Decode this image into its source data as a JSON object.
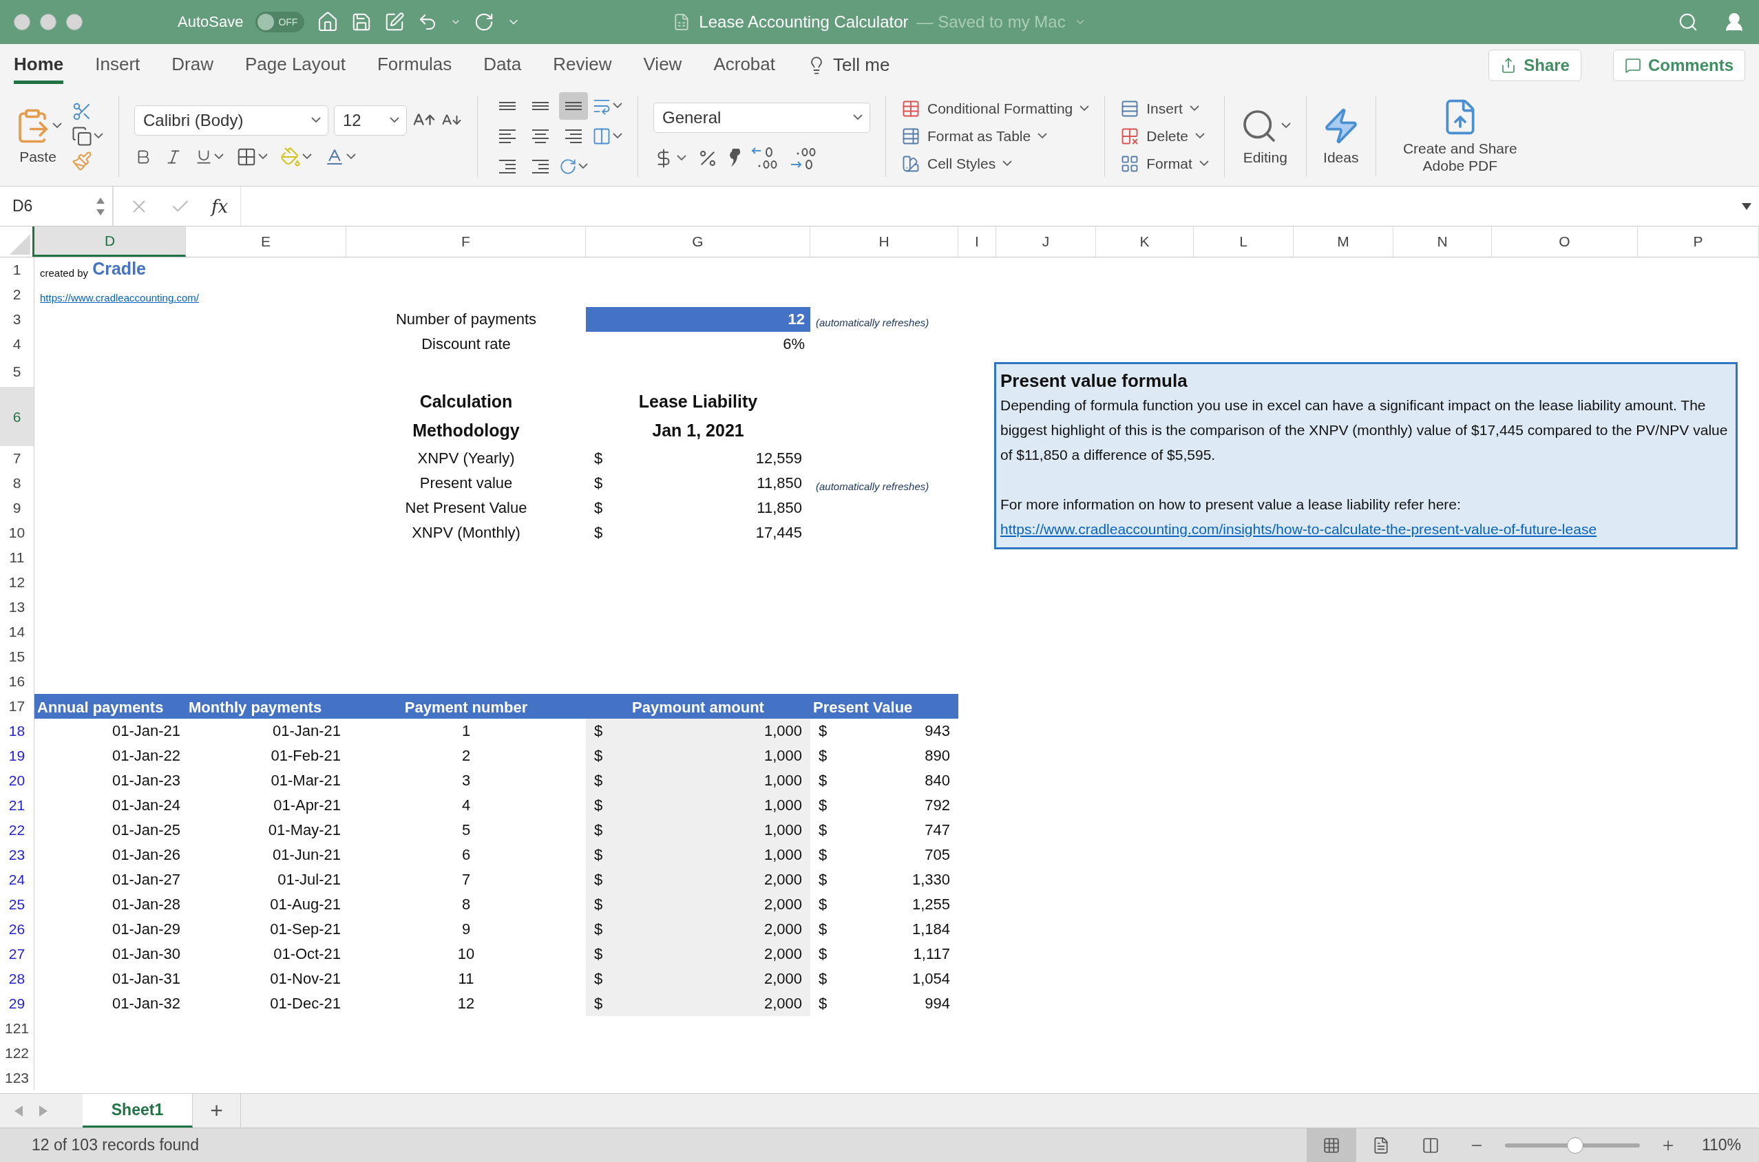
{
  "title_bar": {
    "autosave_label": "AutoSave",
    "autosave_state": "OFF",
    "autosave_on": false,
    "title": "Lease Accounting Calculator",
    "save_status": "— Saved to my Mac"
  },
  "ribbon_tabs": [
    {
      "label": "Home",
      "selected": true
    },
    {
      "label": "Insert",
      "selected": false
    },
    {
      "label": "Draw",
      "selected": false
    },
    {
      "label": "Page Layout",
      "selected": false
    },
    {
      "label": "Formulas",
      "selected": false
    },
    {
      "label": "Data",
      "selected": false
    },
    {
      "label": "Review",
      "selected": false
    },
    {
      "label": "View",
      "selected": false
    },
    {
      "label": "Acrobat",
      "selected": false
    }
  ],
  "tell_me": "Tell me",
  "share": "Share",
  "comments": "Comments",
  "ribbon": {
    "paste": "Paste",
    "font_name": "Calibri (Body)",
    "font_size": "12",
    "vertical_align": [
      {
        "selected": false
      },
      {
        "selected": false
      },
      {
        "selected": true
      }
    ],
    "number_format": "General",
    "styles": [
      "Conditional Formatting",
      "Format as Table",
      "Cell Styles"
    ],
    "cells": [
      "Insert",
      "Delete",
      "Format"
    ],
    "editing": "Editing",
    "ideas": "Ideas",
    "adobe": "Create and Share Adobe PDF"
  },
  "formula_bar": {
    "name_box": "D6",
    "fx_label": "fx"
  },
  "columns": [
    {
      "label": "D",
      "selected": true
    },
    {
      "label": "E",
      "selected": false
    },
    {
      "label": "F",
      "selected": false
    },
    {
      "label": "G",
      "selected": false
    },
    {
      "label": "H",
      "selected": false
    },
    {
      "label": "I",
      "selected": false
    },
    {
      "label": "J",
      "selected": false
    },
    {
      "label": "K",
      "selected": false
    },
    {
      "label": "L",
      "selected": false
    },
    {
      "label": "M",
      "selected": false
    },
    {
      "label": "N",
      "selected": false
    },
    {
      "label": "O",
      "selected": false
    },
    {
      "label": "P",
      "selected": false
    }
  ],
  "rows": [
    {
      "number": "1",
      "selected": false,
      "filtered": false,
      "kind": "credit",
      "prefix": "created by",
      "brand": "Cradle"
    },
    {
      "number": "2",
      "selected": false,
      "filtered": false,
      "kind": "link",
      "url": "https://www.cradleaccounting.com/"
    },
    {
      "number": "3",
      "selected": false,
      "filtered": false,
      "kind": "input",
      "label": "Number of payments",
      "value": "12",
      "highlighted": true,
      "note": "(automatically refreshes)"
    },
    {
      "number": "4",
      "selected": false,
      "filtered": false,
      "kind": "input",
      "label": "Discount rate",
      "value": "6%",
      "highlighted": false
    },
    {
      "number": "5",
      "selected": false,
      "filtered": false,
      "kind": "blank"
    },
    {
      "number": "6",
      "selected": true,
      "filtered": false,
      "kind": "heading",
      "label": "Calculation\nMethodology",
      "value": "Lease Liability\nJan 1, 2021"
    },
    {
      "number": "7",
      "selected": false,
      "filtered": false,
      "kind": "result",
      "label": "XNPV (Yearly)",
      "currency": "$",
      "value": "12,559"
    },
    {
      "number": "8",
      "selected": false,
      "filtered": false,
      "kind": "result",
      "label": "Present value",
      "currency": "$",
      "value": "11,850",
      "note": "(automatically refreshes)"
    },
    {
      "number": "9",
      "selected": false,
      "filtered": false,
      "kind": "result",
      "label": "Net Present Value",
      "currency": "$",
      "value": "11,850"
    },
    {
      "number": "10",
      "selected": false,
      "filtered": false,
      "kind": "result",
      "label": "XNPV (Monthly)",
      "currency": "$",
      "value": "17,445"
    },
    {
      "number": "11",
      "selected": false,
      "filtered": false,
      "kind": "blank"
    },
    {
      "number": "12",
      "selected": false,
      "filtered": false,
      "kind": "blank"
    },
    {
      "number": "13",
      "selected": false,
      "filtered": false,
      "kind": "blank"
    },
    {
      "number": "14",
      "selected": false,
      "filtered": false,
      "kind": "blank"
    },
    {
      "number": "15",
      "selected": false,
      "filtered": false,
      "kind": "blank"
    },
    {
      "number": "16",
      "selected": false,
      "filtered": false,
      "kind": "blank"
    },
    {
      "number": "17",
      "selected": false,
      "filtered": false,
      "kind": "table_header",
      "headers": [
        "Annual payments",
        "Monthly payments",
        "Payment number",
        "Paymount amount",
        "Present Value"
      ]
    },
    {
      "number": "18",
      "selected": false,
      "filtered": true,
      "kind": "payment",
      "annual": "01-Jan-21",
      "monthly": "01-Jan-21",
      "payment": "1",
      "currency": "$",
      "amount": "1,000",
      "pv_currency": "$",
      "pv": "943"
    },
    {
      "number": "19",
      "selected": false,
      "filtered": true,
      "kind": "payment",
      "annual": "01-Jan-22",
      "monthly": "01-Feb-21",
      "payment": "2",
      "currency": "$",
      "amount": "1,000",
      "pv_currency": "$",
      "pv": "890"
    },
    {
      "number": "20",
      "selected": false,
      "filtered": true,
      "kind": "payment",
      "annual": "01-Jan-23",
      "monthly": "01-Mar-21",
      "payment": "3",
      "currency": "$",
      "amount": "1,000",
      "pv_currency": "$",
      "pv": "840"
    },
    {
      "number": "21",
      "selected": false,
      "filtered": true,
      "kind": "payment",
      "annual": "01-Jan-24",
      "monthly": "01-Apr-21",
      "payment": "4",
      "currency": "$",
      "amount": "1,000",
      "pv_currency": "$",
      "pv": "792"
    },
    {
      "number": "22",
      "selected": false,
      "filtered": true,
      "kind": "payment",
      "annual": "01-Jan-25",
      "monthly": "01-May-21",
      "payment": "5",
      "currency": "$",
      "amount": "1,000",
      "pv_currency": "$",
      "pv": "747"
    },
    {
      "number": "23",
      "selected": false,
      "filtered": true,
      "kind": "payment",
      "annual": "01-Jan-26",
      "monthly": "01-Jun-21",
      "payment": "6",
      "currency": "$",
      "amount": "1,000",
      "pv_currency": "$",
      "pv": "705"
    },
    {
      "number": "24",
      "selected": false,
      "filtered": true,
      "kind": "payment",
      "annual": "01-Jan-27",
      "monthly": "01-Jul-21",
      "payment": "7",
      "currency": "$",
      "amount": "2,000",
      "pv_currency": "$",
      "pv": "1,330"
    },
    {
      "number": "25",
      "selected": false,
      "filtered": true,
      "kind": "payment",
      "annual": "01-Jan-28",
      "monthly": "01-Aug-21",
      "payment": "8",
      "currency": "$",
      "amount": "2,000",
      "pv_currency": "$",
      "pv": "1,255"
    },
    {
      "number": "26",
      "selected": false,
      "filtered": true,
      "kind": "payment",
      "annual": "01-Jan-29",
      "monthly": "01-Sep-21",
      "payment": "9",
      "currency": "$",
      "amount": "2,000",
      "pv_currency": "$",
      "pv": "1,184"
    },
    {
      "number": "27",
      "selected": false,
      "filtered": true,
      "kind": "payment",
      "annual": "01-Jan-30",
      "monthly": "01-Oct-21",
      "payment": "10",
      "currency": "$",
      "amount": "2,000",
      "pv_currency": "$",
      "pv": "1,117"
    },
    {
      "number": "28",
      "selected": false,
      "filtered": true,
      "kind": "payment",
      "annual": "01-Jan-31",
      "monthly": "01-Nov-21",
      "payment": "11",
      "currency": "$",
      "amount": "2,000",
      "pv_currency": "$",
      "pv": "1,054"
    },
    {
      "number": "29",
      "selected": false,
      "filtered": true,
      "kind": "payment",
      "annual": "01-Jan-32",
      "monthly": "01-Dec-21",
      "payment": "12",
      "currency": "$",
      "amount": "2,000",
      "pv_currency": "$",
      "pv": "994"
    },
    {
      "number": "121",
      "selected": false,
      "filtered": false,
      "kind": "blank"
    },
    {
      "number": "122",
      "selected": false,
      "filtered": false,
      "kind": "blank"
    },
    {
      "number": "123",
      "selected": false,
      "filtered": false,
      "kind": "blank"
    }
  ],
  "text_box": {
    "title": "Present value formula",
    "body": "Depending of formula function you use in excel can have a significant impact on the lease liability amount. The biggest highlight of this is the comparison of the XNPV (monthly) value of $17,445 compared to the PV/NPV value of $11,850 a difference of $5,595.",
    "more": "For more information on how to present value a lease liability refer here:",
    "link": "https://www.cradleaccounting.com/insights/how-to-calculate-the-present-value-of-future-lease"
  },
  "sheet_tabs": [
    {
      "label": "Sheet1",
      "selected": true
    }
  ],
  "add_sheet": "+",
  "status_bar": {
    "text": "12 of 103 records found",
    "views": [
      {
        "kind": "normal",
        "selected": true
      },
      {
        "kind": "page_layout",
        "selected": false
      },
      {
        "kind": "page_break",
        "selected": false
      }
    ],
    "zoom": {
      "level": 0.52,
      "reading": "110%"
    }
  }
}
